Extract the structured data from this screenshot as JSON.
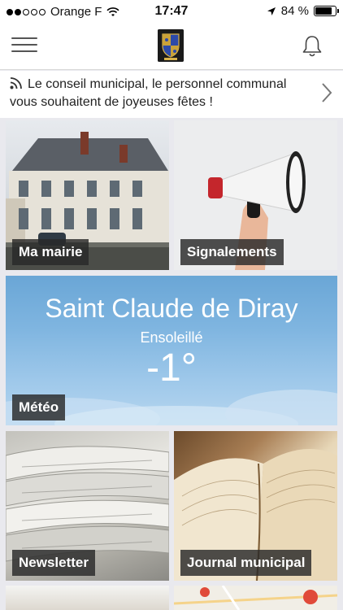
{
  "status_bar": {
    "carrier": "Orange F",
    "time": "17:47",
    "battery_percent": "84 %",
    "battery_level": 0.84
  },
  "nav": {
    "menu_icon": "hamburger-icon",
    "logo": "town-crest-logo",
    "bell_icon": "bell-icon"
  },
  "announcement": {
    "text": "Le conseil municipal, le personnel communal vous souhaitent de joyeuses fêtes !",
    "icon": "rss-icon"
  },
  "tiles": {
    "mairie": {
      "label": "Ma mairie"
    },
    "signalements": {
      "label": "Signalements"
    },
    "meteo": {
      "label": "Météo",
      "city": "Saint Claude de Diray",
      "condition": "Ensoleillé",
      "temperature": "-1°"
    },
    "newsletter": {
      "label": "Newsletter"
    },
    "journal": {
      "label": "Journal municipal"
    }
  },
  "colors": {
    "label_bg": "#2b2b2b",
    "sky": "#7fb5e0"
  }
}
